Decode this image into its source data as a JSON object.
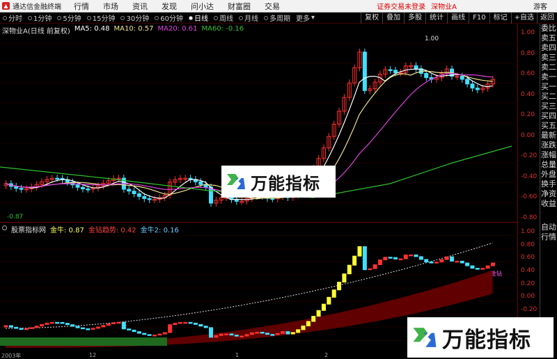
{
  "app": {
    "title": "通达信金融终端",
    "menu": [
      "行情",
      "市场",
      "资讯",
      "发现",
      "问小达",
      "财富圈",
      "交易"
    ],
    "notice": "证券交易未登录",
    "stock_tag": "深物业A",
    "guest": "游客"
  },
  "toolbar": {
    "periods": [
      "分时",
      "1分钟",
      "5分钟",
      "15分钟",
      "30分钟",
      "60分钟",
      "日线",
      "周线",
      "月线",
      "多周期",
      "更多"
    ],
    "active_period": "日线",
    "tools": [
      "复权",
      "叠加",
      "多股",
      "统计",
      "画线",
      "F10",
      "标记"
    ],
    "tool_icons": [
      "+自选",
      "返回"
    ]
  },
  "main_chart": {
    "legend_title": "深物业A(日线 前复权)",
    "ma": [
      {
        "label": "MA5: 0.48",
        "color": "#ffffff"
      },
      {
        "label": "MA10: 0.57",
        "color": "#f0e68c"
      },
      {
        "label": "MA20: 0.61",
        "color": "#e040e0"
      },
      {
        "label": "MA60: -0.16",
        "color": "#30c030"
      }
    ],
    "high_label": "1.00",
    "low_label": "-0.87",
    "axis": [
      "1.00",
      "0.80",
      "0.60",
      "0.40",
      "0.20",
      "0.00",
      "-0.20",
      "-0.40",
      "-0.60",
      "-0.80"
    ]
  },
  "indicator": {
    "legend_title": "股票指标网",
    "items": [
      {
        "label": "金牛: 0.87",
        "color": "#ffff66"
      },
      {
        "label": "金钻趋势: 0.42",
        "color": "#ff4040"
      },
      {
        "label": "金牛2: 0.16",
        "color": "#66ccff"
      }
    ],
    "tag": "金钻",
    "axis": [
      "1.00",
      "0.80",
      "0.60",
      "0.40",
      "0.20",
      "0.00",
      "-0.20",
      "-0.40",
      "-0.60",
      "-0.80"
    ]
  },
  "right_menu": [
    "委比",
    "卖五",
    "卖四",
    "卖三",
    "卖二",
    "卖一",
    "买一",
    "买二",
    "买三",
    "买四",
    "买五",
    "最新",
    "涨跌",
    "涨幅",
    "总量",
    "外盘",
    "换手",
    "净资",
    "收益",
    "自动",
    "行情"
  ],
  "datebar": [
    "2003年",
    "12",
    "1",
    "2"
  ],
  "watermark": {
    "text": "万能指标"
  },
  "colors": {
    "up": "#ff3030",
    "down": "#40e0ff",
    "axis": "#dd3333",
    "grid": "#700000",
    "ma5": "#ffffff",
    "ma10": "#f0e68c",
    "ma20": "#e040e0",
    "ma60": "#30c030"
  }
}
